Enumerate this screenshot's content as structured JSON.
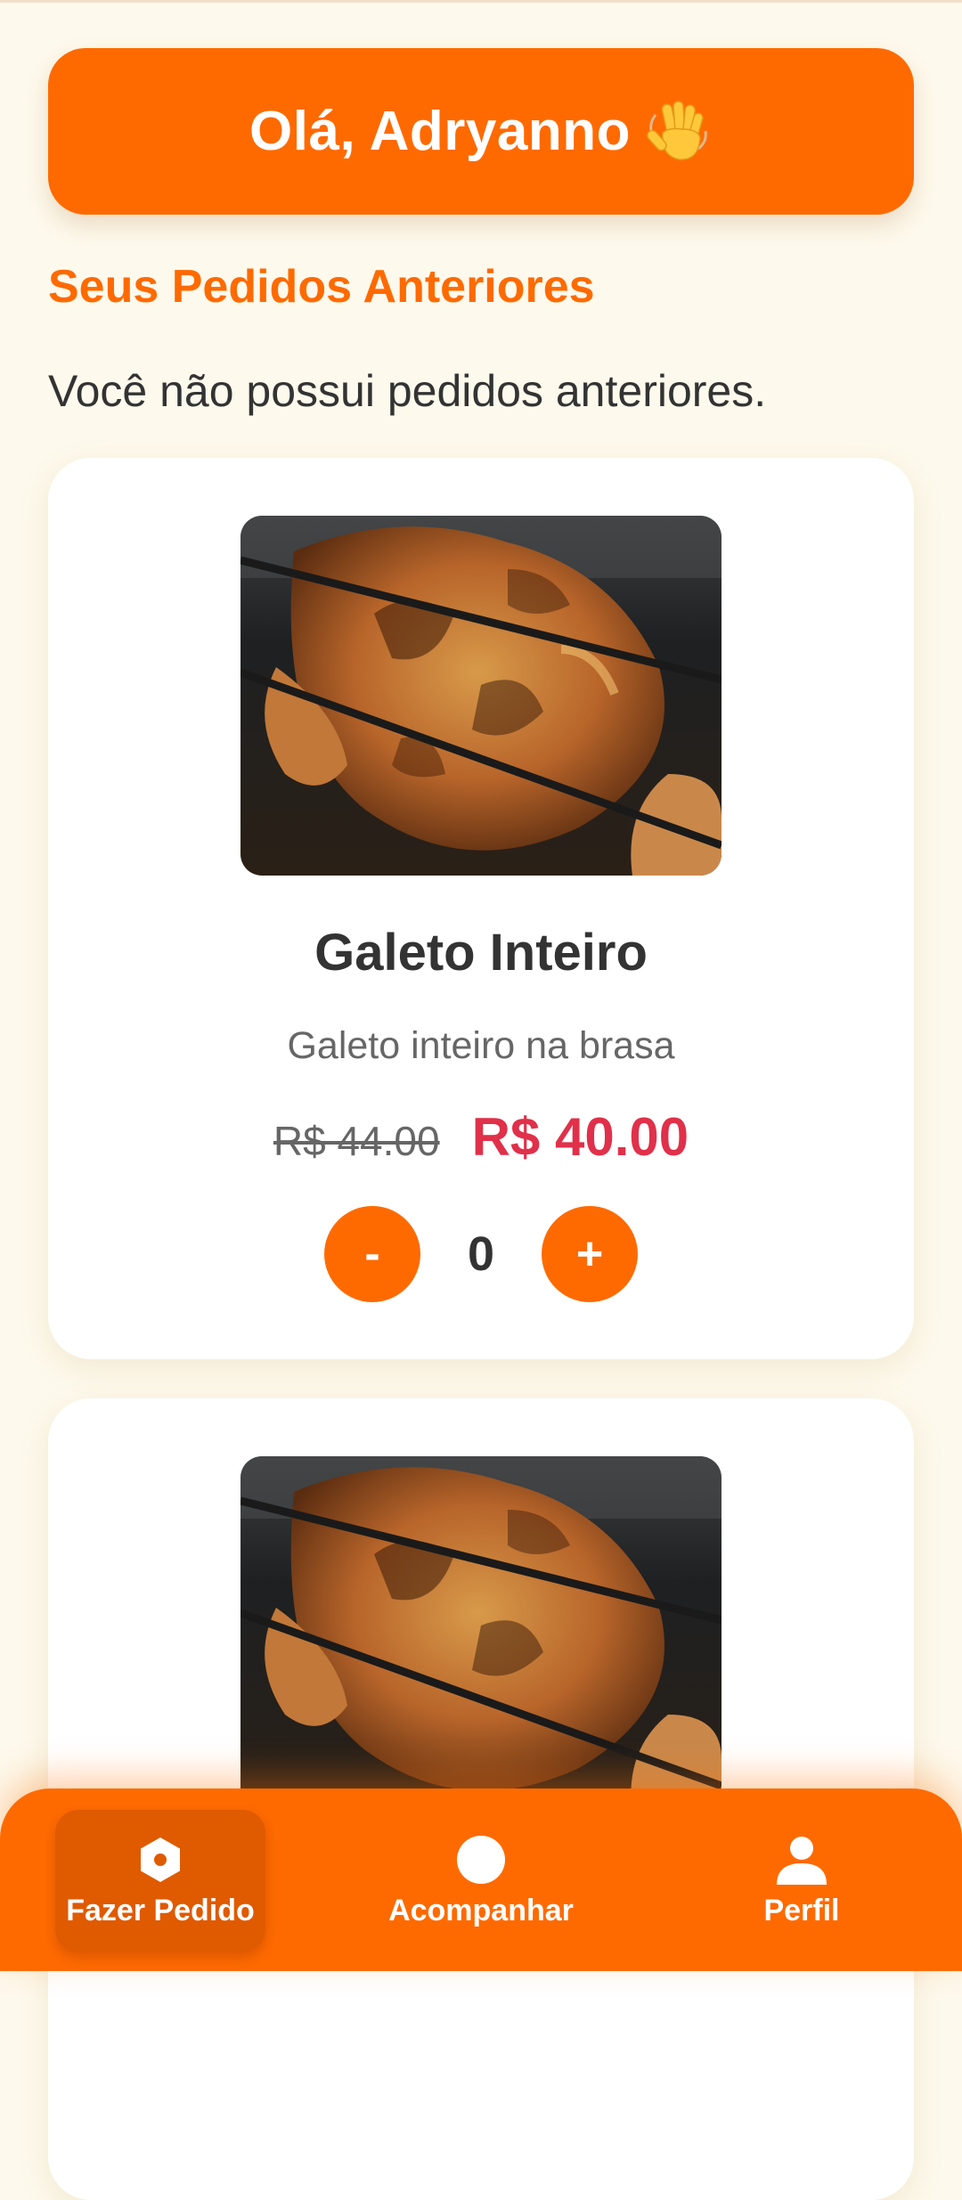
{
  "header": {
    "greeting": "Olá, Adryanno",
    "greeting_icon": "waving-hand-icon"
  },
  "previous_orders": {
    "title": "Seus Pedidos Anteriores",
    "empty_message": "Você não possui pedidos anteriores."
  },
  "products": [
    {
      "image": "roast-chicken-photo",
      "name": "Galeto Inteiro",
      "description": "Galeto inteiro na brasa",
      "old_price": "R$ 44.00",
      "price": "R$ 40.00",
      "decrement_label": "-",
      "quantity": "0",
      "increment_label": "+"
    },
    {
      "image": "roast-chicken-photo"
    }
  ],
  "bottom_nav": [
    {
      "label": "Fazer Pedido",
      "icon": "hexagon-icon",
      "active": true
    },
    {
      "label": "Acompanhar",
      "icon": "circle-icon",
      "active": false
    },
    {
      "label": "Perfil",
      "icon": "person-icon",
      "active": false
    }
  ],
  "colors": {
    "accent": "#ff6a00",
    "background": "#fdf9ec",
    "price": "#e0304a"
  }
}
